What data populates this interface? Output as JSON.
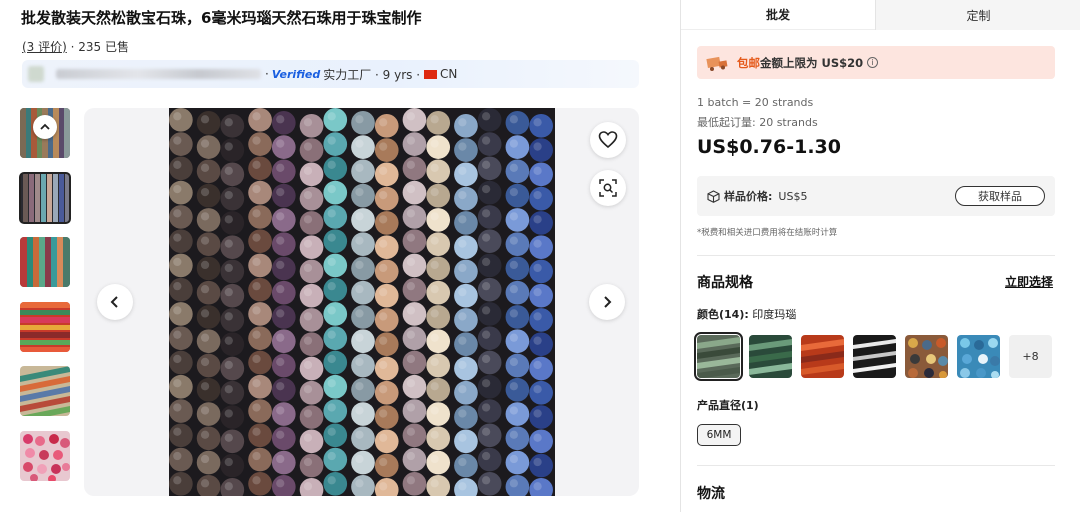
{
  "product": {
    "title": "批发散装天然松散宝石珠，6毫米玛瑙天然石珠用于珠宝制作",
    "reviews_link": "(3 评价)",
    "sold_text": " · 235 已售"
  },
  "supplier": {
    "verified_label": "Verified",
    "badge_text": "实力工厂 · 9 yrs · ",
    "country": "CN"
  },
  "gallery": {
    "thumbnail_count": 6,
    "active_thumbnail_index": 1,
    "icons": [
      "chevron-up-icon",
      "heart-icon",
      "image-search-icon",
      "chevron-left-icon",
      "chevron-right-icon"
    ]
  },
  "tabs": [
    {
      "label": "批发",
      "active": true
    },
    {
      "label": "定制",
      "active": false
    }
  ],
  "promo": {
    "highlight": "包邮",
    "text": "金额上限为 US$20",
    "info_icon": "ⓘ"
  },
  "pricing": {
    "batch_text": "1 batch = 20 strands",
    "moq_text": "最低起订量:  20 strands",
    "price_range": "US$0.76-1.30"
  },
  "sample": {
    "label": "样品价格:",
    "price": "US$5",
    "button_label": "获取样品"
  },
  "tax_note": "*税费和相关进口费用将在结账时计算",
  "specs": {
    "title": "商品规格",
    "select_now": "立即选择",
    "color_label_prefix": "颜色(14):",
    "color_selected": " 印度玛瑙",
    "more_colors": "+8",
    "diameter_label": "产品直径(1)",
    "diameter_value": "6MM"
  },
  "logistics_title": "物流",
  "colors": {
    "accent_orange": "#e55a1b",
    "promo_bg": "#fde5df",
    "verified_blue": "#1a5fe0"
  }
}
